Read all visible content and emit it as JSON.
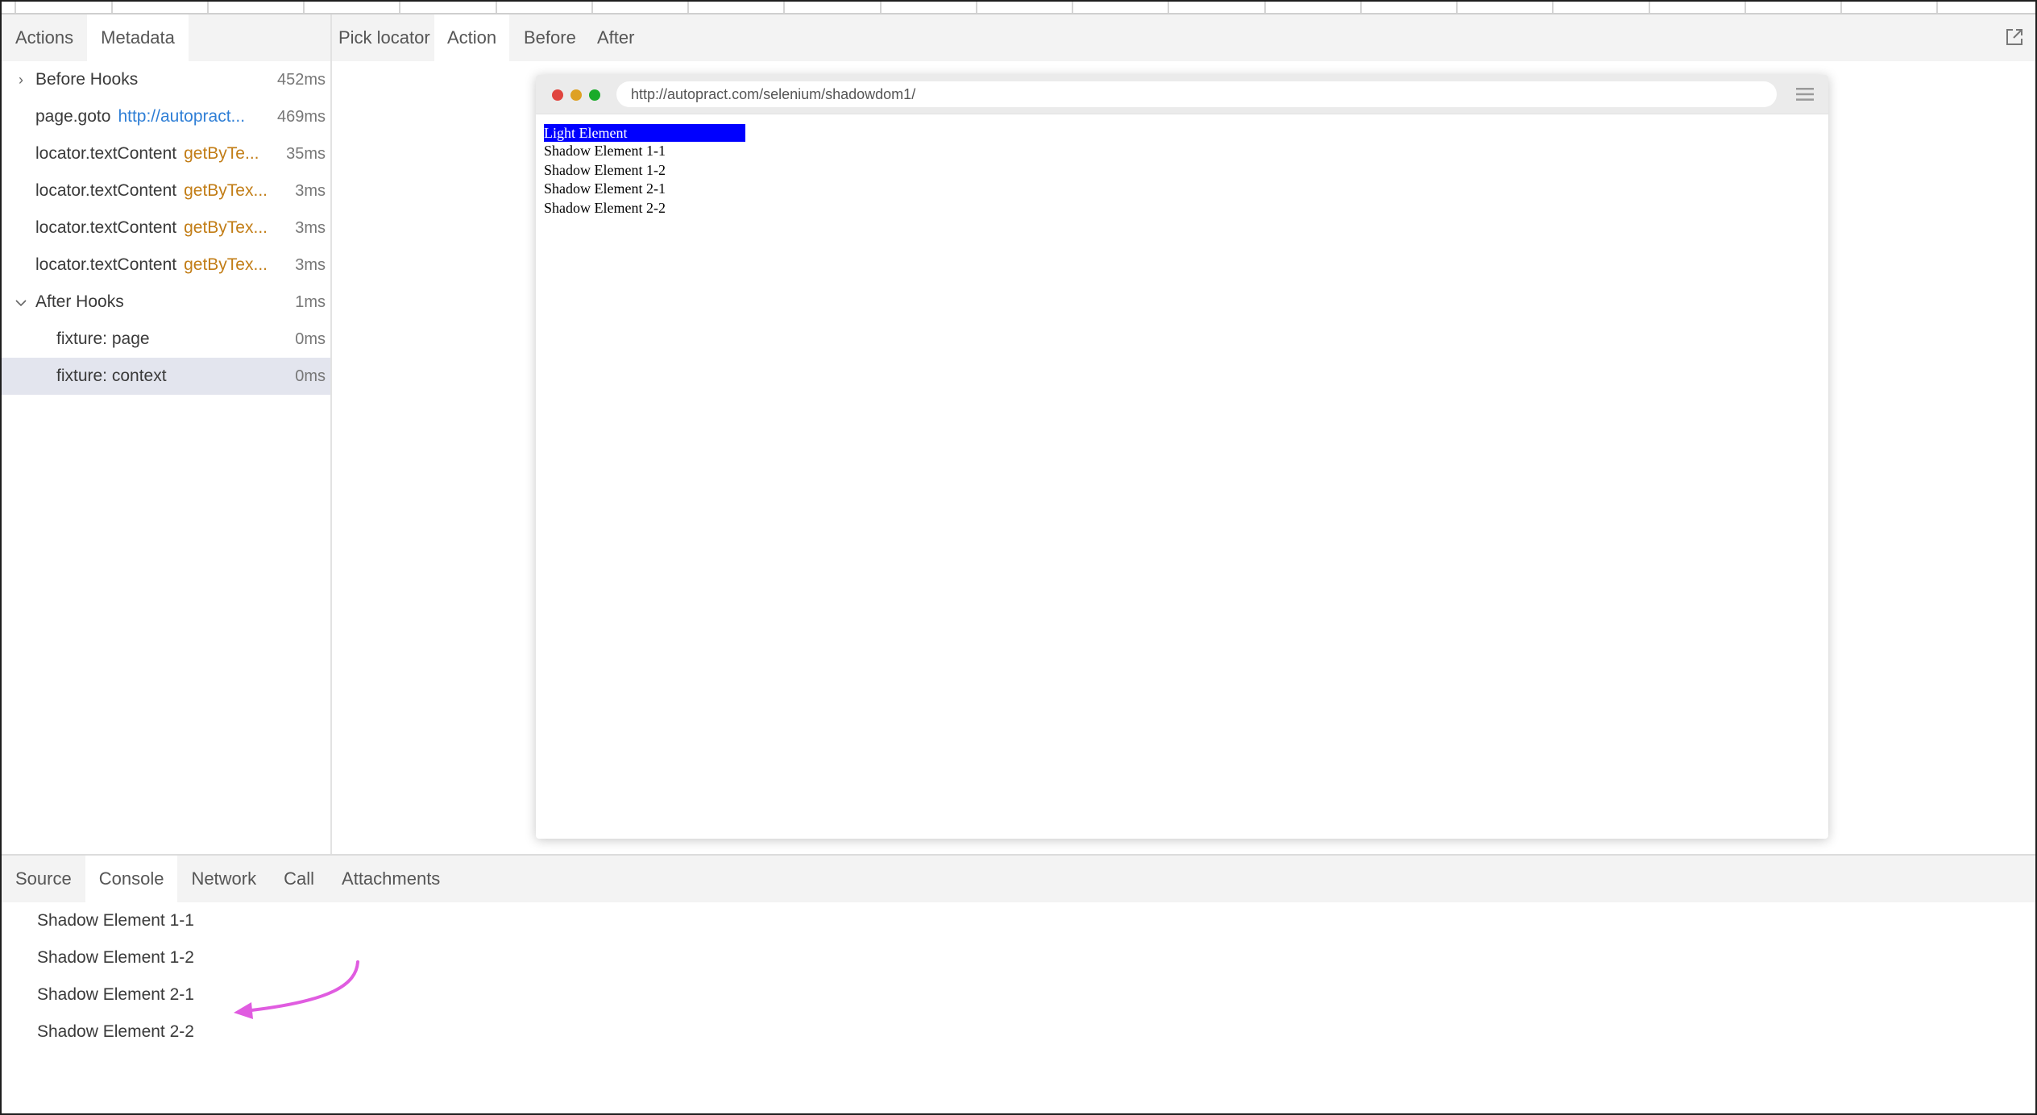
{
  "left_panel": {
    "tabs": [
      "Actions",
      "Metadata"
    ],
    "actions": [
      {
        "chevron": "›",
        "title": "Before Hooks",
        "detail": "",
        "duration": "452ms"
      },
      {
        "chevron": "",
        "title": "page.goto",
        "detail": "http://autopract...",
        "duration": "469ms"
      },
      {
        "chevron": "",
        "title": "locator.textContent",
        "detail": "getByTe...",
        "duration": "35ms"
      },
      {
        "chevron": "",
        "title": "locator.textContent",
        "detail": "getByTex...",
        "duration": "3ms"
      },
      {
        "chevron": "",
        "title": "locator.textContent",
        "detail": "getByTex...",
        "duration": "3ms"
      },
      {
        "chevron": "",
        "title": "locator.textContent",
        "detail": "getByTex...",
        "duration": "3ms"
      },
      {
        "chevron": "⌄",
        "title": "After Hooks",
        "detail": "",
        "duration": "1ms"
      },
      {
        "chevron": "",
        "title": "fixture: page",
        "detail": "",
        "duration": "0ms"
      },
      {
        "chevron": "",
        "title": "fixture: context",
        "detail": "",
        "duration": "0ms"
      }
    ]
  },
  "right_panel": {
    "tabs": [
      "Pick locator",
      "Action",
      "Before",
      "After"
    ],
    "browser": {
      "url": "http://autopract.com/selenium/shadowdom1/",
      "light_element": "Light Element",
      "shadow_elements": [
        "Shadow Element 1-1",
        "Shadow Element 1-2",
        "Shadow Element 2-1",
        "Shadow Element 2-2"
      ]
    }
  },
  "bottom_panel": {
    "tabs": [
      "Source",
      "Console",
      "Network",
      "Call",
      "Attachments"
    ],
    "console_lines": [
      "Shadow Element 1-1",
      "Shadow Element 1-2",
      "Shadow Element 2-1",
      "Shadow Element 2-2"
    ]
  },
  "colors": {
    "locator": "#c27d16",
    "url": "#2f7fd6",
    "selected_row": "#e3e5ee",
    "highlight": "#0000ff",
    "annotation_arrow": "#e05ce0"
  },
  "icons": [
    "chevron-right-icon",
    "chevron-down-icon",
    "popout-icon",
    "hamburger-menu-icon",
    "annotation-arrow-icon"
  ]
}
